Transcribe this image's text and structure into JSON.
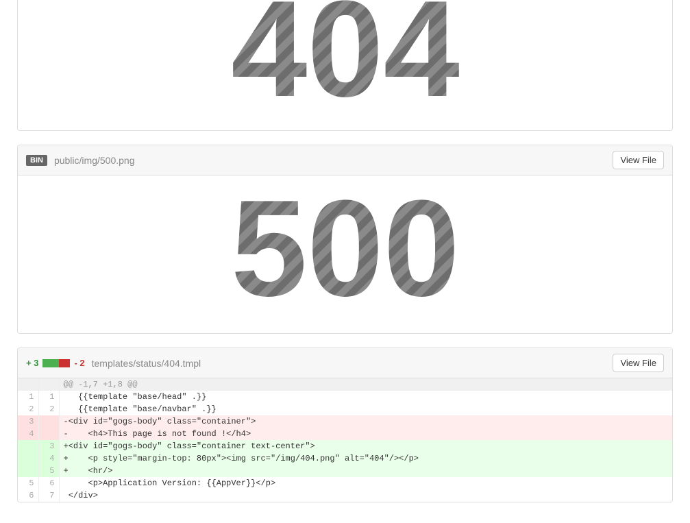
{
  "top_image": {
    "text": "404"
  },
  "file_500": {
    "bin_label": "BIN",
    "path": "public/img/500.png",
    "view_file": "View File",
    "text": "500"
  },
  "file_tmpl": {
    "plus": "+ 3",
    "minus": "- 2",
    "path": "templates/status/404.tmpl",
    "view_file": "View File",
    "diff": {
      "hunk": "@@ -1,7 +1,8 @@",
      "rows": [
        {
          "old": "1",
          "new": "1",
          "type": "ctx",
          "code": "   {{template \"base/head\" .}}"
        },
        {
          "old": "2",
          "new": "2",
          "type": "ctx",
          "code": "   {{template \"base/navbar\" .}}"
        },
        {
          "old": "3",
          "new": "",
          "type": "del",
          "code": "-<div id=\"gogs-body\" class=\"container\">"
        },
        {
          "old": "4",
          "new": "",
          "type": "del",
          "code": "-    <h4>This page is not found !</h4>"
        },
        {
          "old": "",
          "new": "3",
          "type": "add",
          "code": "+<div id=\"gogs-body\" class=\"container text-center\">"
        },
        {
          "old": "",
          "new": "4",
          "type": "add",
          "code": "+    <p style=\"margin-top: 80px\"><img src=\"/img/404.png\" alt=\"404\"/></p>"
        },
        {
          "old": "",
          "new": "5",
          "type": "add",
          "code": "+    <hr/>"
        },
        {
          "old": "5",
          "new": "6",
          "type": "ctx",
          "code": "     <p>Application Version: {{AppVer}}</p>"
        },
        {
          "old": "6",
          "new": "7",
          "type": "ctx",
          "code": " </div>"
        }
      ]
    }
  }
}
